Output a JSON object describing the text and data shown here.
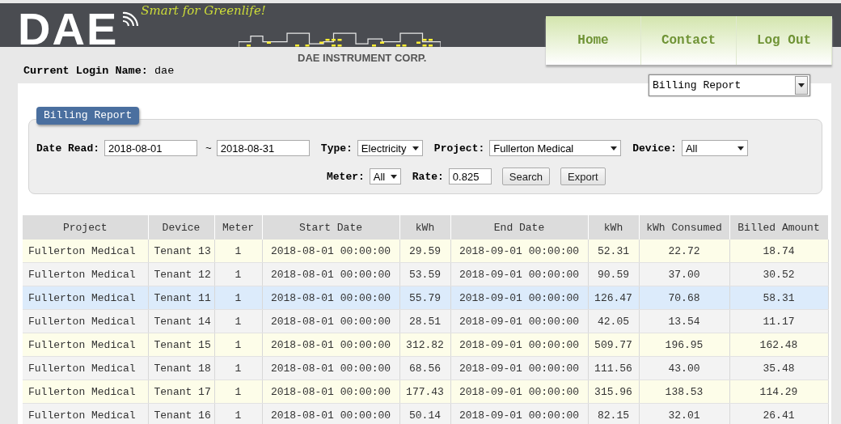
{
  "header": {
    "logo": "DAE",
    "tagline": "Smart for Greenlife!",
    "company": "DAE INSTRUMENT CORP.",
    "nav": [
      {
        "label": "Home"
      },
      {
        "label": "Contact"
      },
      {
        "label": "Log Out"
      }
    ]
  },
  "login": {
    "label": "Current Login Name:",
    "value": "dae"
  },
  "report_select": {
    "value": "Billing Report"
  },
  "filter_panel": {
    "title": "Billing Report",
    "date": {
      "label": "Date Read:",
      "from": "2018-08-01",
      "separator": "~",
      "to": "2018-08-31"
    },
    "type": {
      "label": "Type:",
      "value": "Electricity"
    },
    "project": {
      "label": "Project:",
      "value": "Fullerton Medical"
    },
    "device": {
      "label": "Device:",
      "value": "All"
    },
    "meter": {
      "label": "Meter:",
      "value": "All"
    },
    "rate": {
      "label": "Rate:",
      "value": "0.825"
    },
    "buttons": [
      "Search",
      "Export"
    ]
  },
  "table": {
    "columns": [
      "Project",
      "Device",
      "Meter",
      "Start Date",
      "kWh",
      "End Date",
      "kWh",
      "kWh Consumed",
      "Billed Amount"
    ],
    "rows": [
      {
        "selected": false,
        "cells": [
          "Fullerton Medical",
          "Tenant 13",
          "1",
          "2018-08-01 00:00:00",
          "29.59",
          "2018-09-01 00:00:00",
          "52.31",
          "22.72",
          "18.74"
        ]
      },
      {
        "selected": false,
        "cells": [
          "Fullerton Medical",
          "Tenant 12",
          "1",
          "2018-08-01 00:00:00",
          "53.59",
          "2018-09-01 00:00:00",
          "90.59",
          "37.00",
          "30.52"
        ]
      },
      {
        "selected": true,
        "cells": [
          "Fullerton Medical",
          "Tenant 11",
          "1",
          "2018-08-01 00:00:00",
          "55.79",
          "2018-09-01 00:00:00",
          "126.47",
          "70.68",
          "58.31"
        ]
      },
      {
        "selected": false,
        "cells": [
          "Fullerton Medical",
          "Tenant 14",
          "1",
          "2018-08-01 00:00:00",
          "28.51",
          "2018-09-01 00:00:00",
          "42.05",
          "13.54",
          "11.17"
        ]
      },
      {
        "selected": false,
        "cells": [
          "Fullerton Medical",
          "Tenant 15",
          "1",
          "2018-08-01 00:00:00",
          "312.82",
          "2018-09-01 00:00:00",
          "509.77",
          "196.95",
          "162.48"
        ]
      },
      {
        "selected": false,
        "cells": [
          "Fullerton Medical",
          "Tenant 18",
          "1",
          "2018-08-01 00:00:00",
          "68.56",
          "2018-09-01 00:00:00",
          "111.56",
          "43.00",
          "35.48"
        ]
      },
      {
        "selected": false,
        "cells": [
          "Fullerton Medical",
          "Tenant 17",
          "1",
          "2018-08-01 00:00:00",
          "177.43",
          "2018-09-01 00:00:00",
          "315.96",
          "138.53",
          "114.29"
        ]
      },
      {
        "selected": false,
        "cells": [
          "Fullerton Medical",
          "Tenant 16",
          "1",
          "2018-08-01 00:00:00",
          "50.14",
          "2018-09-01 00:00:00",
          "82.15",
          "32.01",
          "26.41"
        ]
      }
    ]
  }
}
